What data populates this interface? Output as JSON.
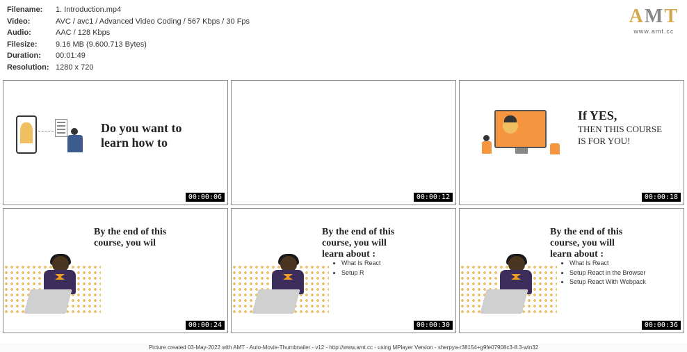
{
  "meta": {
    "filename_label": "Filename:",
    "filename_value": "1. Introduction.mp4",
    "video_label": "Video:",
    "video_value": "AVC / avc1 / Advanced Video Coding / 567 Kbps / 30 Fps",
    "audio_label": "Audio:",
    "audio_value": "AAC / 128 Kbps",
    "filesize_label": "Filesize:",
    "filesize_value": "9.16 MB (9.600.713 Bytes)",
    "duration_label": "Duration:",
    "duration_value": "00:01:49",
    "resolution_label": "Resolution:",
    "resolution_value": "1280 x 720"
  },
  "logo": {
    "text_a": "A",
    "text_m": "M",
    "text_t": "T",
    "url": "www.amt.cc"
  },
  "thumbs": [
    {
      "ts": "00:00:06",
      "title": "Do you want to\nlearn how to"
    },
    {
      "ts": "00:00:12"
    },
    {
      "ts": "00:00:18",
      "yes": "If YES,",
      "sub": "THEN THIS COURSE\nIS FOR YOU!"
    },
    {
      "ts": "00:00:24",
      "title": "By the end of this\ncourse, you wil"
    },
    {
      "ts": "00:00:30",
      "title": "By the end of this\ncourse, you will\nlearn about :",
      "b1": "What Is React",
      "b2": "Setup R"
    },
    {
      "ts": "00:00:36",
      "title": "By the end of this\ncourse, you will\nlearn about :",
      "b1": "What Is React",
      "b2": "Setup React in the Browser",
      "b3": "Setup React With Webpack"
    }
  ],
  "footer": "Picture created 03-May-2022 with AMT - Auto-Movie-Thumbnailer - v12 - http://www.amt.cc - using MPlayer Version - sherpya-r38154+g9fe07908c3-8.3-win32"
}
